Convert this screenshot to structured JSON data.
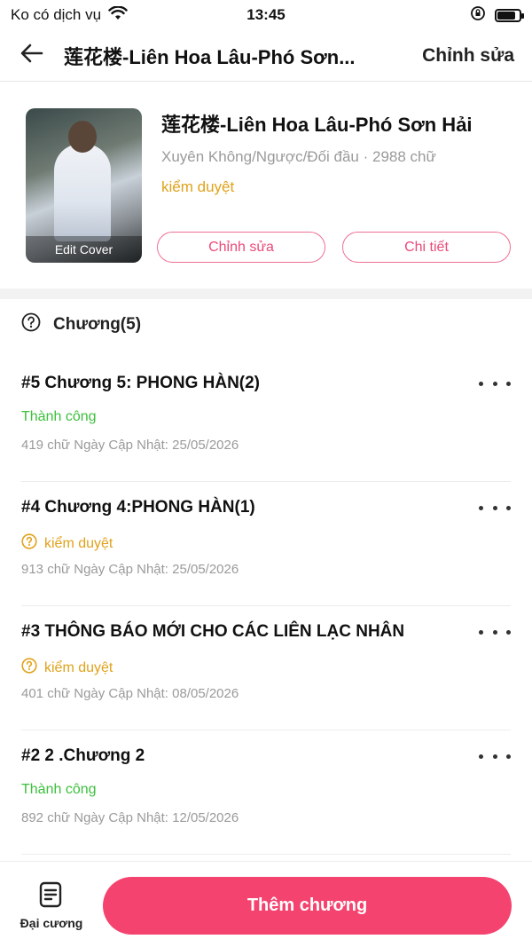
{
  "status_bar": {
    "carrier": "Ko có dịch vụ",
    "time": "13:45",
    "battery_level": 0.85
  },
  "nav": {
    "title": "莲花楼-Liên Hoa Lâu-Phó Sơn...",
    "action_label": "Chỉnh sửa",
    "back_icon": "arrow-left-icon"
  },
  "book": {
    "cover_label": "Edit Cover",
    "title": "莲花楼-Liên Hoa Lâu-Phó Sơn Hải",
    "meta": "Xuyên Không/Ngược/Đối đầu · 2988 chữ",
    "status": "kiểm duyệt",
    "edit_label": "Chỉnh sửa",
    "detail_label": "Chi tiết"
  },
  "chapters_header": {
    "label": "Chương(5)",
    "icon": "question-circle-icon"
  },
  "chapters": [
    {
      "title": "#5 Chương 5: PHONG HÀN(2)",
      "status": "Thành công",
      "status_type": "success",
      "meta": "419 chữ Ngày Cập Nhật: 25/05/2026"
    },
    {
      "title": "#4 Chương 4:PHONG HÀN(1)",
      "status": "kiểm duyệt",
      "status_type": "review",
      "meta": "913 chữ Ngày Cập Nhật: 25/05/2026"
    },
    {
      "title": "#3 THÔNG BÁO MỚI CHO CÁC LIÊN LẠC NHÂN",
      "status": "kiểm duyệt",
      "status_type": "review",
      "meta": "401 chữ Ngày Cập Nhật: 08/05/2026"
    },
    {
      "title": "#2 2 .Chương 2",
      "status": "Thành công",
      "status_type": "success",
      "meta": "892 chữ Ngày Cập Nhật: 12/05/2026"
    }
  ],
  "bottom_bar": {
    "outline_label": "Đại cương",
    "add_chapter_label": "Thêm chương"
  },
  "colors": {
    "accent": "#f4436f",
    "success": "#3cbf3c",
    "review": "#e0a21a",
    "muted": "#9a9a9a"
  }
}
